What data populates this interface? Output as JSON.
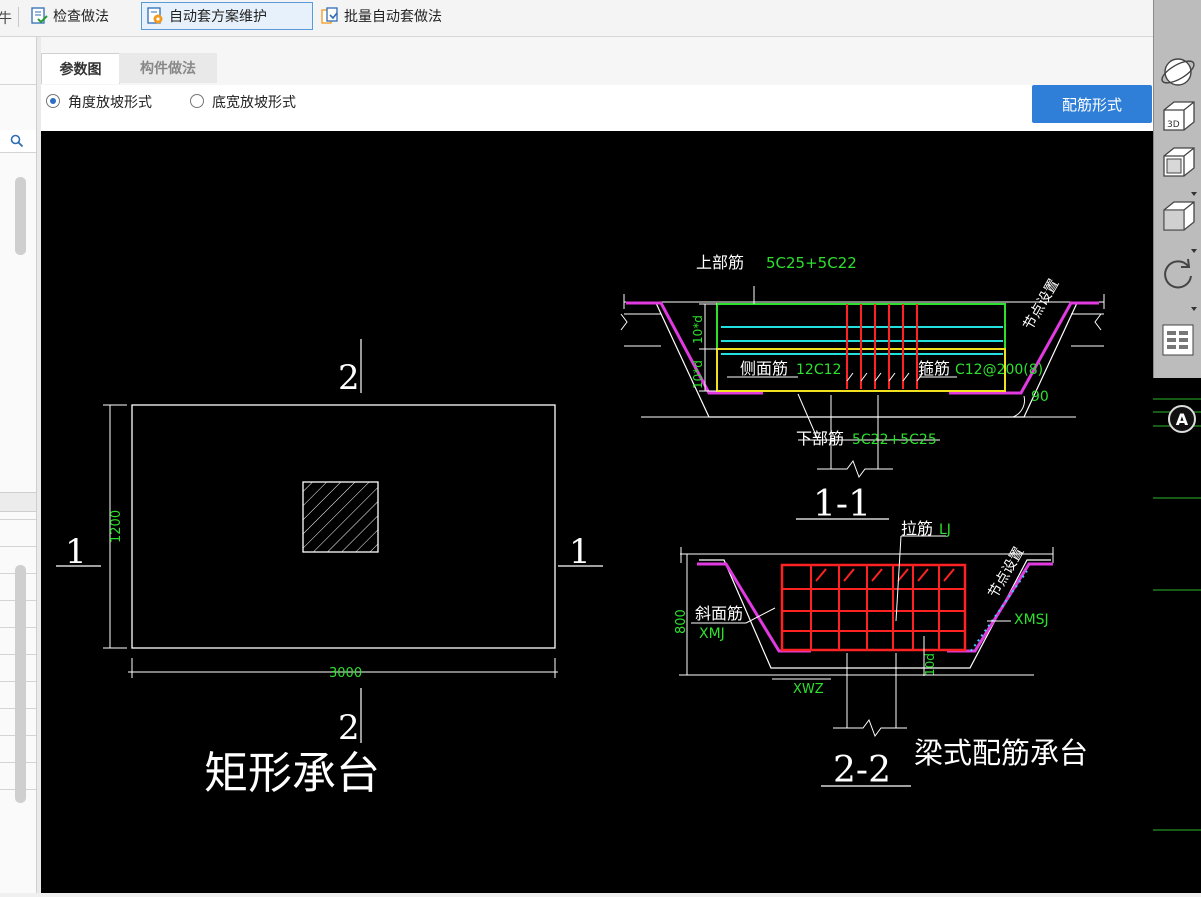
{
  "toolbar": {
    "check_method": "检查做法",
    "auto_plan_maintain": "自动套方案维护",
    "batch_auto_method": "批量自动套做法",
    "left_fragment": "牛"
  },
  "tabs": {
    "param_diagram": "参数图",
    "component_method": "构件做法"
  },
  "options": {
    "angle_slope": "角度放坡形式",
    "bottom_width_slope": "底宽放坡形式",
    "selected": "角度放坡形式",
    "rebar_form_button": "配筋形式"
  },
  "right_tools": {
    "view_3d_label": "3D",
    "axis_label": "A"
  },
  "drawing": {
    "rect_cap": {
      "section_1_left": "1",
      "section_1_right": "1",
      "section_2_top": "2",
      "section_2_bottom": "2",
      "height_dim": "1200",
      "width_dim": "3000",
      "title": "矩形承台"
    },
    "section_1_1": {
      "top_bar_label": "上部筋",
      "top_bar_value": "5C25+5C22",
      "node_setting": "节点设置",
      "side_dim_a": "10*d",
      "side_dim_b": "10*d",
      "side_dim_c": "10*d",
      "side_bar_label": "侧面筋",
      "side_bar_value": "12C12",
      "stirrup_label": "箍筋",
      "stirrup_value": "C12@200(8)",
      "angle": "90",
      "bottom_bar_label": "下部筋",
      "bottom_bar_value": "5C22+5C25",
      "section_title": "1-1"
    },
    "section_2_2": {
      "tie_bar_label": "拉筋",
      "tie_bar_value": "LJ",
      "node_setting": "节点设置",
      "height_dim": "800",
      "slant_bar_label": "斜面筋",
      "slant_bar_value": "XMJ",
      "xmsj": "XMSJ",
      "xwz": "XWZ",
      "dim_10d": "10d",
      "section_title": "2-2",
      "title": "梁式配筋承台"
    }
  }
}
